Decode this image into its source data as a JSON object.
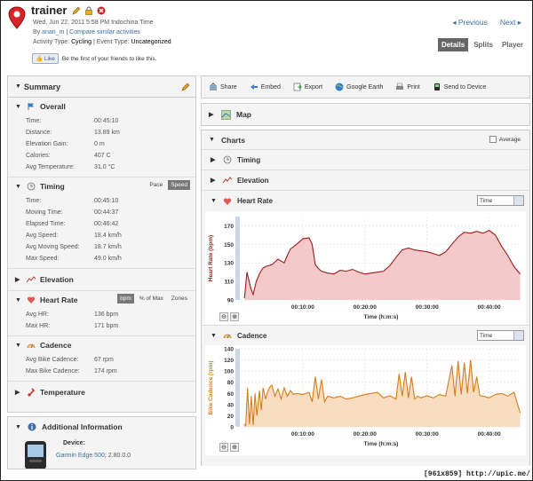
{
  "activity": {
    "title": "trainer",
    "datetime": "Wed, Jun 22, 2011 5:58 PM Indochina Time",
    "by_prefix": "By ",
    "author": "anan_m",
    "sep": " | ",
    "compare": "Compare similar activities",
    "type_label": "Activity Type: ",
    "type_value": "Cycling",
    "event_label": " | Event Type: ",
    "event_value": "Uncategorized",
    "like_label": "Like",
    "like_text": "Be the first of your friends to like this."
  },
  "nav": {
    "previous": "◂ Previous",
    "next": "Next ▸"
  },
  "tabs": [
    {
      "label": "Details"
    },
    {
      "label": "Splits"
    },
    {
      "label": "Player"
    }
  ],
  "summary": {
    "title": "Summary",
    "overall": {
      "title": "Overall",
      "rows": [
        {
          "k": "Time:",
          "v": "00:45:10"
        },
        {
          "k": "Distance:",
          "v": "13.89 km"
        },
        {
          "k": "Elevation Gain:",
          "v": "0 m"
        },
        {
          "k": "Calories:",
          "v": "407 C"
        },
        {
          "k": "Avg Temperature:",
          "v": "31.0 °C"
        }
      ]
    },
    "timing": {
      "title": "Timing",
      "tabs": [
        "Pace",
        "Speed"
      ],
      "rows": [
        {
          "k": "Time:",
          "v": "00:45:10"
        },
        {
          "k": "Moving Time:",
          "v": "00:44:37"
        },
        {
          "k": "Elapsed Time:",
          "v": "00:46:42"
        },
        {
          "k": "Avg Speed:",
          "v": "18.4 km/h"
        },
        {
          "k": "Avg Moving Speed:",
          "v": "18.7 km/h"
        },
        {
          "k": "Max Speed:",
          "v": "49.0 km/h"
        }
      ]
    },
    "elevation": {
      "title": "Elevation"
    },
    "heart_rate": {
      "title": "Heart Rate",
      "tabs": [
        "bpm",
        "% of Max",
        "Zones"
      ],
      "rows": [
        {
          "k": "Avg HR:",
          "v": "136 bpm"
        },
        {
          "k": "Max HR:",
          "v": "171 bpm"
        }
      ]
    },
    "cadence": {
      "title": "Cadence",
      "rows": [
        {
          "k": "Avg Bike Cadence:",
          "v": "67 rpm"
        },
        {
          "k": "Max Bike Cadence:",
          "v": "174 rpm"
        }
      ]
    },
    "temperature": {
      "title": "Temperature"
    }
  },
  "additional": {
    "title": "Additional Information",
    "device_label": "Device:",
    "device_name": "Garmin Edge 500",
    "device_version": ", 2.80.0.0"
  },
  "toolbar": {
    "share": "Share",
    "embed": "Embed",
    "export": "Export",
    "google_earth": "Google Earth",
    "print": "Print",
    "send": "Send to Device"
  },
  "map": {
    "title": "Map"
  },
  "charts": {
    "title": "Charts",
    "average": "Average",
    "timing": "Timing",
    "elevation": "Elevation",
    "heart_rate": "Heart Rate",
    "cadence": "Cadence",
    "time_option": "Time"
  },
  "chart_data": [
    {
      "type": "area",
      "title": "Heart Rate",
      "ylabel": "Heart Rate (bpm)",
      "xlabel": "Time (h:m:s)",
      "ylim": [
        90,
        180
      ],
      "yticks": [
        90,
        110,
        130,
        150,
        170
      ],
      "xticks": [
        "00:10:00",
        "00:20:00",
        "00:30:00",
        "00:40:00"
      ],
      "xlim_min": [
        0,
        45.2
      ],
      "color": "#9e1b1b",
      "fill": "#f3c9c9",
      "x": [
        0.6,
        1,
        1.6,
        2,
        2.5,
        3,
        3.5,
        4,
        5,
        6,
        7,
        7.5,
        8,
        9,
        10,
        11,
        11.5,
        12,
        12.5,
        13,
        14,
        15,
        16,
        17,
        18,
        19,
        20,
        21,
        22,
        23,
        24,
        25,
        26,
        27,
        28,
        29,
        30,
        31,
        32,
        33,
        34,
        35,
        36,
        37,
        38,
        39,
        40,
        41,
        42,
        43,
        44,
        45
      ],
      "y": [
        92,
        120,
        103,
        96,
        110,
        118,
        124,
        126,
        128,
        134,
        130,
        138,
        145,
        150,
        156,
        157,
        150,
        128,
        124,
        121,
        119,
        118,
        122,
        121,
        123,
        120,
        118,
        119,
        120,
        121,
        127,
        136,
        144,
        146,
        144,
        143,
        142,
        140,
        138,
        142,
        150,
        158,
        163,
        162,
        164,
        162,
        165,
        160,
        148,
        138,
        126,
        118
      ]
    },
    {
      "type": "area",
      "title": "Cadence",
      "ylabel": "Bike Cadence (rpm)",
      "xlabel": "Time (h:m:s)",
      "ylim": [
        0,
        140
      ],
      "yticks": [
        0,
        20,
        40,
        60,
        80,
        100,
        120,
        140
      ],
      "xticks": [
        "00:10:00",
        "00:20:00",
        "00:30:00",
        "00:40:00"
      ],
      "xlim_min": [
        0,
        45.2
      ],
      "color": "#d67d1a",
      "fill": "#f7dcc0",
      "x": [
        0.5,
        0.8,
        1.1,
        1.4,
        1.7,
        2,
        2.3,
        2.6,
        3,
        3.3,
        3.6,
        4,
        4.3,
        4.6,
        5,
        5.5,
        6,
        6.5,
        7,
        7.5,
        8,
        8.5,
        9,
        10,
        11,
        11.5,
        12,
        12.5,
        13,
        13.5,
        14,
        15,
        16,
        17,
        18,
        19,
        20,
        21,
        22,
        23,
        24,
        25,
        25.5,
        26,
        26.5,
        27,
        27.5,
        28,
        28.5,
        29,
        30,
        31,
        32,
        33,
        34,
        34.5,
        35,
        35.5,
        36,
        36.5,
        37,
        37.5,
        38,
        38.5,
        39,
        40,
        41,
        42,
        43,
        44,
        45
      ],
      "y": [
        5,
        2,
        70,
        5,
        55,
        3,
        60,
        20,
        65,
        30,
        70,
        50,
        62,
        70,
        75,
        55,
        68,
        50,
        70,
        55,
        65,
        58,
        60,
        58,
        62,
        45,
        90,
        50,
        85,
        45,
        55,
        52,
        55,
        50,
        52,
        55,
        58,
        60,
        62,
        52,
        56,
        50,
        95,
        55,
        98,
        52,
        90,
        50,
        55,
        52,
        56,
        52,
        58,
        55,
        110,
        55,
        118,
        58,
        115,
        60,
        120,
        62,
        90,
        56,
        55,
        52,
        58,
        60,
        55,
        62,
        25
      ]
    }
  ]
}
